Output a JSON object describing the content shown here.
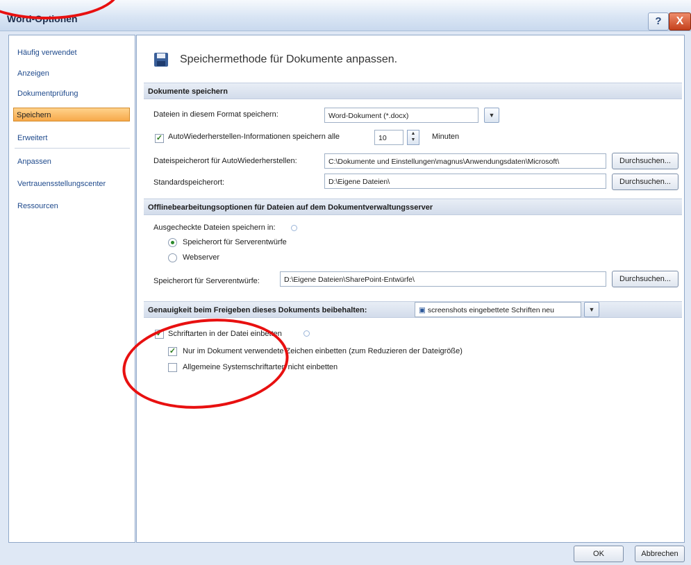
{
  "window": {
    "title": "Word-Optionen",
    "help_label": "?",
    "close_label": "X"
  },
  "sidebar": {
    "items": [
      {
        "label": "Häufig verwendet"
      },
      {
        "label": "Anzeigen"
      },
      {
        "label": "Dokumentprüfung"
      },
      {
        "label": "Speichern",
        "selected": true
      },
      {
        "label": "Erweitert"
      },
      {
        "label": "Anpassen"
      },
      {
        "label": "Vertrauensstellungscenter"
      },
      {
        "label": "Ressourcen"
      }
    ]
  },
  "main": {
    "title": "Speichermethode für Dokumente anpassen.",
    "save_section": {
      "header": "Dokumente speichern",
      "format_label": "Dateien in diesem Format speichern:",
      "format_value": "Word-Dokument (*.docx)",
      "autorecover_checked": true,
      "autorecover_label": "AutoWiederherstellen-Informationen speichern alle",
      "autorecover_minutes": "10",
      "minutes_label": "Minuten",
      "autorecover_path_label": "Dateispeicherort für AutoWiederherstellen:",
      "autorecover_path_value": "C:\\Dokumente und Einstellungen\\magnus\\Anwendungsdaten\\Microsoft\\",
      "default_path_label": "Standardspeicherort:",
      "default_path_value": "D:\\Eigene Dateien\\",
      "browse_label": "Durchsuchen..."
    },
    "offline_section": {
      "header": "Offlinebearbeitungsoptionen für Dateien auf dem Dokumentverwaltungsserver",
      "checkout_label": "Ausgecheckte Dateien speichern in:",
      "radio_server_drafts": "Speicherort für Serverentwürfe",
      "radio_webserver": "Webserver",
      "selected_radio": "Speicherort für Serverentwürfe",
      "server_drafts_label": "Speicherort für Serverentwürfe:",
      "server_drafts_value": "D:\\Eigene Dateien\\SharePoint-Entwürfe\\",
      "browse_label": "Durchsuchen..."
    },
    "fidelity_section": {
      "header": "Genauigkeit beim Freigeben dieses Dokuments beibehalten:",
      "document_value": "screenshots eingebettete Schriften neu",
      "embed_fonts_checked": true,
      "embed_fonts_label": "Schriftarten in der Datei einbetten",
      "embed_used_checked": true,
      "embed_used_label": "Nur im Dokument verwendete Zeichen einbetten (zum Reduzieren der Dateigröße)",
      "no_system_fonts_checked": false,
      "no_system_fonts_label": "Allgemeine Systemschriftarten nicht einbetten"
    }
  },
  "footer": {
    "ok_label": "OK",
    "cancel_label": "Abbrechen"
  },
  "colors": {
    "selected_nav": "#f7a94a",
    "annotation": "#e81010"
  }
}
